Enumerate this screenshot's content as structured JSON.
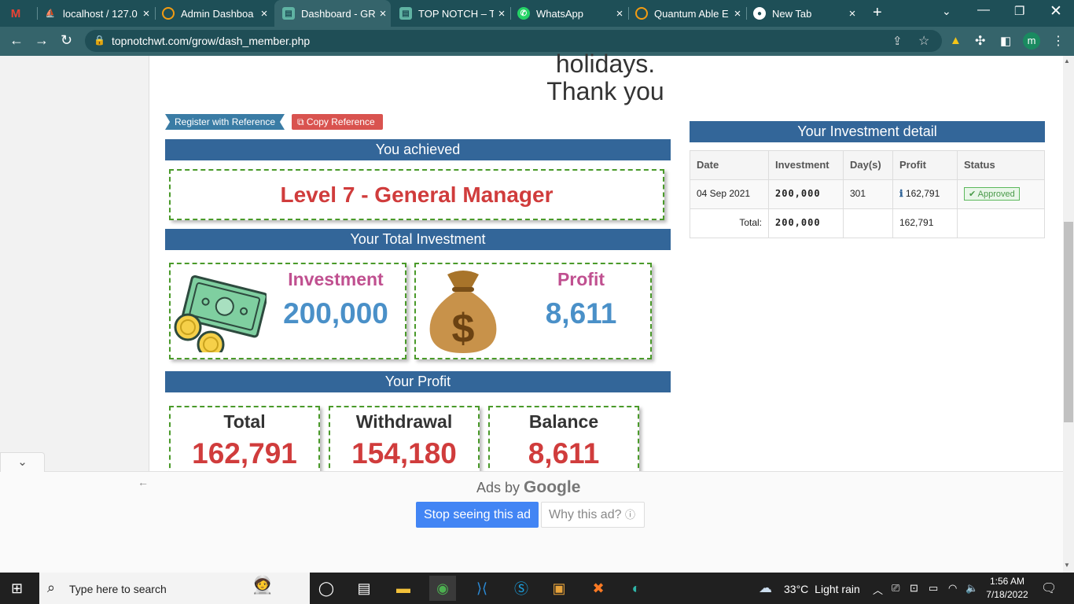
{
  "browser": {
    "tabs": [
      {
        "title": "",
        "icon": "gmail-icon"
      },
      {
        "title": "localhost / 127.0",
        "icon": "phpmyadmin-icon"
      },
      {
        "title": "Admin Dashboa",
        "icon": "quantum-icon"
      },
      {
        "title": "Dashboard - GR",
        "icon": "page-icon"
      },
      {
        "title": "TOP NOTCH – To",
        "icon": "page-icon"
      },
      {
        "title": "WhatsApp",
        "icon": "whatsapp-icon"
      },
      {
        "title": "Quantum Able E",
        "icon": "quantum-icon"
      },
      {
        "title": "New Tab",
        "icon": "chrome-icon"
      }
    ],
    "url": "topnotchwt.com/grow/dash_member.php",
    "profile_initial": "m"
  },
  "page": {
    "notice_line1": "holidays.",
    "notice_line2": "Thank you",
    "register_ref_label": "Register with Reference",
    "copy_ref_label": "Copy Reference",
    "achieved_title": "You achieved",
    "level_text": "Level 7 - General Manager",
    "total_investment_title": "Your Total Investment",
    "investment_label": "Investment",
    "investment_value": "200,000",
    "profit_label": "Profit",
    "profit_value": "8,611",
    "your_profit_title": "Your Profit",
    "profit_cards": [
      {
        "label": "Total",
        "value": "162,791"
      },
      {
        "label": "Withdrawal",
        "value": "154,180"
      },
      {
        "label": "Balance",
        "value": "8,611"
      }
    ],
    "investment_detail": {
      "title": "Your Investment detail",
      "headers": [
        "Date",
        "Investment",
        "Day(s)",
        "Profit",
        "Status"
      ],
      "row": {
        "date": "04 Sep 2021",
        "investment": "200,000",
        "days": "301",
        "profit": "162,791",
        "status": "Approved"
      },
      "total_label": "Total:",
      "total_investment": "200,000",
      "total_profit": "162,791"
    }
  },
  "ad": {
    "ads_by": "Ads by",
    "google": "Google",
    "stop_label": "Stop seeing this ad",
    "why_label": "Why this ad?"
  },
  "taskbar": {
    "search_placeholder": "Type here to search",
    "weather_temp": "33°C",
    "weather_desc": "Light rain",
    "time": "1:56 AM",
    "date": "7/18/2022"
  },
  "colors": {
    "accent_blue": "#336699",
    "level_red": "#d03c3c",
    "value_blue": "#4a90c8",
    "label_pink": "#c05090"
  }
}
